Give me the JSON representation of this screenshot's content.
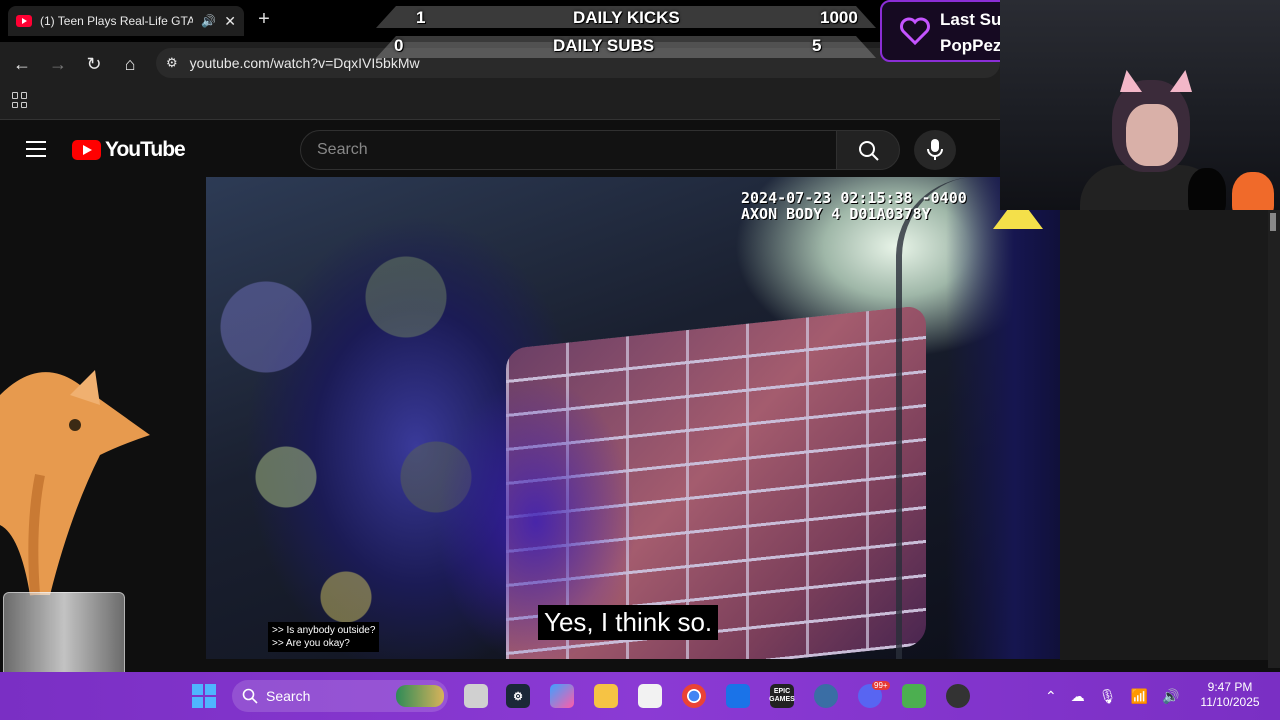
{
  "browser": {
    "tab_title": "(1) Teen Plays Real-Life GTA",
    "new_tab": "+",
    "url": "youtube.com/watch?v=DqxIVI5bkMw"
  },
  "youtube": {
    "logo_text": "YouTube",
    "search_placeholder": "Search"
  },
  "video": {
    "overlay_line1": "2024-07-23 02:15:38 -0400",
    "overlay_line2": "AXON BODY 4 D01A0378Y",
    "caption_small_1": ">> Is anybody outside?",
    "caption_small_2": ">> Are you okay?",
    "caption_large": "Yes, I think so."
  },
  "stream_overlay": {
    "kicks_current": "1",
    "kicks_label": "DAILY KICKS",
    "kicks_goal": "1000",
    "subs_current": "0",
    "subs_label": "DAILY SUBS",
    "subs_goal": "5",
    "last_sub_label": "Last Sub",
    "last_sub_name": "PopPez",
    "accent_color": "#8b2ed6"
  },
  "taskbar": {
    "search_label": "Search",
    "discord_badge": "99+",
    "epic_label": "EPIC GAMES",
    "time": "9:47 PM",
    "date": "11/10/2025"
  }
}
